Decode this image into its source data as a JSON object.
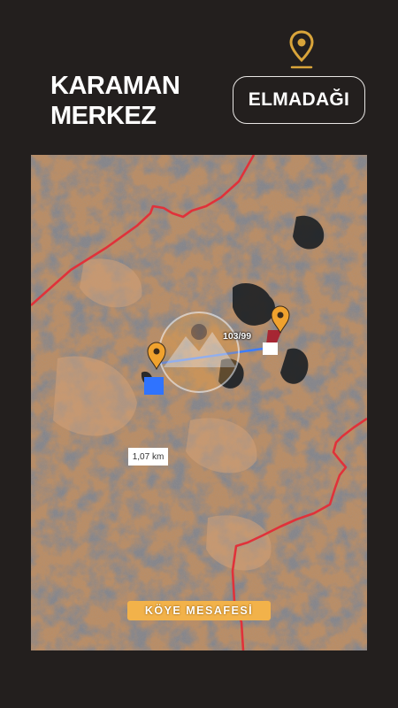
{
  "header": {
    "title_line1": "KARAMAN",
    "title_line2": "MERKEZ",
    "district_label": "ELMADAĞI"
  },
  "map": {
    "distance_label": "1,07 km",
    "parcel_label": "103/99",
    "village_distance_badge": "KÖYE MESAFESİ"
  },
  "colors": {
    "background": "#231f1e",
    "accent_pin": "#f0b030",
    "boundary_line": "#e03030",
    "distance_line": "#3a7bff",
    "badge": "#f2b24a"
  },
  "icons": [
    "location-pin-icon",
    "map-marker-icon",
    "watermark-logo"
  ]
}
